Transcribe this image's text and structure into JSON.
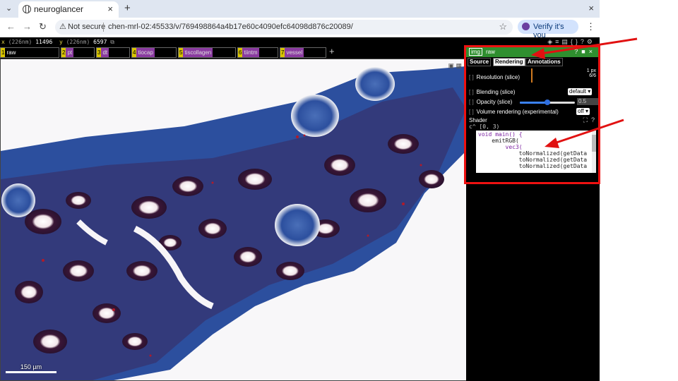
{
  "browser": {
    "tab_title": "neuroglancer",
    "url": "chen-mrl-02:45533/v/769498864a4b17e60c4090efc64098d876c20089/",
    "security_label": "Not secure",
    "verify_label": "Verify it's you"
  },
  "ng": {
    "coords": {
      "x_label": "x",
      "x_unit": "(226nm)",
      "x_value": "11496",
      "y_label": "y",
      "y_unit": "(226nm)",
      "y_value": "6597"
    },
    "layers": [
      {
        "num": "1",
        "name": "raw"
      },
      {
        "num": "2",
        "name": "pt"
      },
      {
        "num": "3",
        "name": "dt"
      },
      {
        "num": "4",
        "name": "tiocap"
      },
      {
        "num": "5",
        "name": "tiscollagen"
      },
      {
        "num": "6",
        "name": "tiintm"
      },
      {
        "num": "7",
        "name": "vessel"
      }
    ],
    "add_layer": "+",
    "scale_label": "150 µm",
    "panel": {
      "layer_type": "img",
      "layer_name": "raw",
      "tabs": [
        "Source",
        "Rendering",
        "Annotations"
      ],
      "active_tab": "Rendering",
      "resolution_label": "Resolution (slice)",
      "resolution_value": "1 px",
      "resolution_count": "6/6",
      "blending_label": "Blending (slice)",
      "blending_value": "default",
      "opacity_label": "Opacity (slice)",
      "opacity_value": "0.5",
      "opacity_fraction": 0.5,
      "volume_label": "Volume rendering (experimental)",
      "volume_value": "off",
      "shader_label": "Shader",
      "shader_channel": "c^ [0, 3)",
      "shader_lines": [
        "void main() {",
        "    emitRGB(",
        "        vec3(",
        "            toNormalized(getData",
        "            toNormalized(getData",
        "            toNormalized(getData"
      ]
    }
  },
  "colors": {
    "annotation_red": "#e11111",
    "layer_header_green": "#2f8f2f",
    "tissue_blue": "#2c4f9e",
    "tissue_dark": "#2a1230"
  }
}
